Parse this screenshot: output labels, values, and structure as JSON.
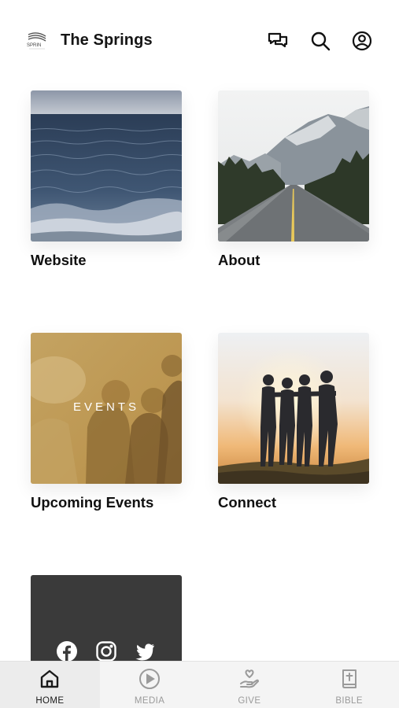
{
  "header": {
    "title": "The Springs",
    "logo_text": "SPRIN",
    "icons": [
      "chat-icon",
      "search-icon",
      "profile-icon"
    ]
  },
  "tiles": [
    {
      "label": "Website",
      "image": "ocean-water"
    },
    {
      "label": "About",
      "image": "mountain-road"
    },
    {
      "label": "Upcoming Events",
      "image": "events-people",
      "overlay": "EVENTS"
    },
    {
      "label": "Connect",
      "image": "friends-sunset"
    }
  ],
  "social_tile": {
    "icons": [
      "facebook-icon",
      "instagram-icon",
      "twitter-icon"
    ],
    "background": "#3a3a3a"
  },
  "tabbar": {
    "tabs": [
      {
        "label": "HOME",
        "icon": "home-icon",
        "active": true
      },
      {
        "label": "MEDIA",
        "icon": "play-icon",
        "active": false
      },
      {
        "label": "GIVE",
        "icon": "give-icon",
        "active": false
      },
      {
        "label": "BIBLE",
        "icon": "bible-icon",
        "active": false
      }
    ]
  },
  "colors": {
    "active": "#1a1a1a",
    "inactive": "#9a9a9a",
    "events_tint": "#c9a15a"
  }
}
